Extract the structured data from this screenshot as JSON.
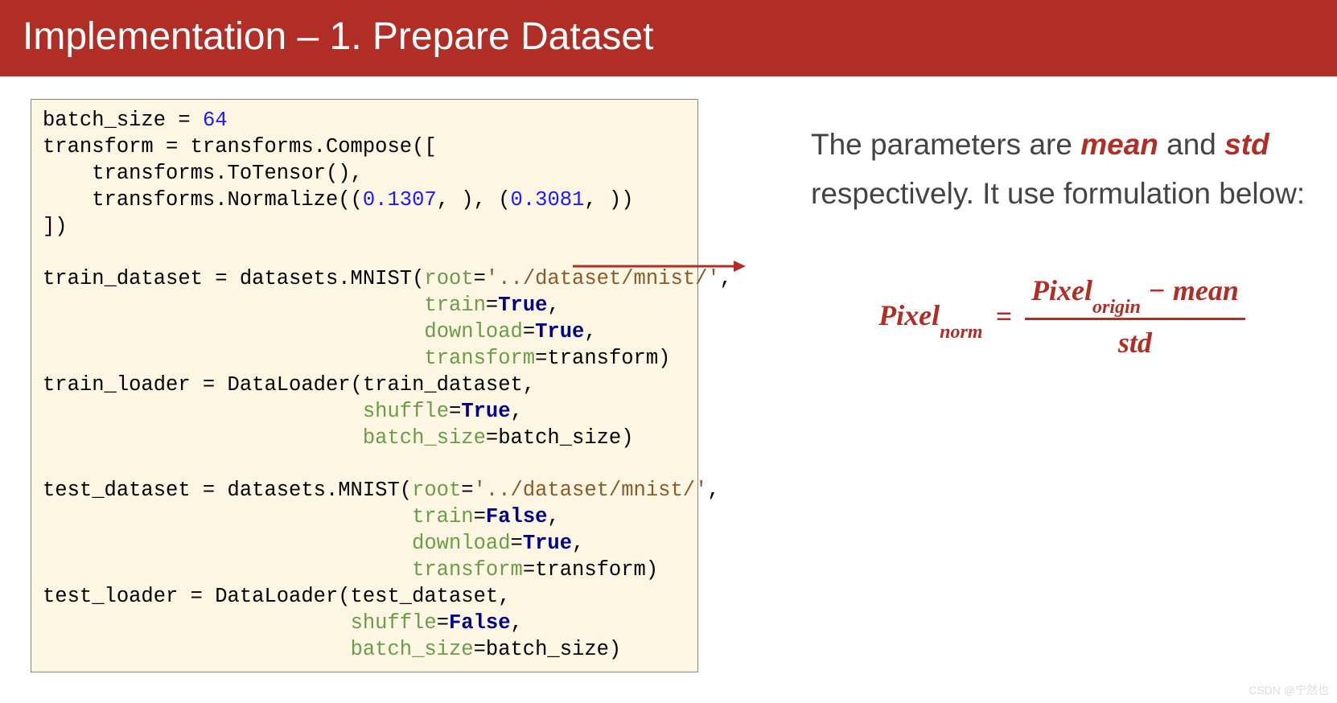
{
  "title": "Implementation – 1. Prepare Dataset",
  "code": {
    "batch_size_var": "batch_size",
    "batch_size_val": "64",
    "compose": "transform = transforms.Compose([",
    "totensor": "    transforms.ToTensor(),",
    "normalize_pre": "    transforms.Normalize((",
    "mean_val": "0.1307",
    "mid": ", ), (",
    "std_val": "0.3081",
    "normalize_post": ", ))",
    "compose_end": "])",
    "train_ds_pre": "train_dataset = datasets.MNIST(",
    "root_arg": "root",
    "root_path": "'../dataset/mnist/'",
    "train_arg": "train",
    "download_arg": "download",
    "transform_arg": "transform",
    "true_val": "True",
    "false_val": "False",
    "transform_val": "=transform)",
    "train_loader": "train_loader = DataLoader(train_dataset,",
    "shuffle_arg": "shuffle",
    "bs_arg": "batch_size",
    "bs_tail": "=batch_size)",
    "test_ds_pre": "test_dataset = datasets.MNIST(",
    "test_loader": "test_loader = DataLoader(test_dataset,"
  },
  "explain": {
    "t1": "The parameters are ",
    "mean": "mean",
    "and": " and ",
    "std": "std",
    "t2": " respectively. It use formulation below:"
  },
  "formula": {
    "pixel": "Pixel",
    "norm": "norm",
    "eq": "=",
    "origin": "origin",
    "minus": " − ",
    "mean": "mean",
    "std": "std"
  },
  "watermark": "CSDN @宁然也"
}
